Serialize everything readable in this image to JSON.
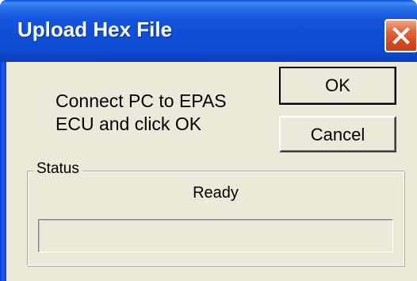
{
  "window": {
    "title": "Upload Hex File",
    "close_icon": "close-icon"
  },
  "message": {
    "line1": "Connect PC to EPAS",
    "line2": "ECU and click OK"
  },
  "buttons": {
    "ok_label": "OK",
    "cancel_label": "Cancel"
  },
  "status": {
    "group_label": "Status",
    "text": "Ready",
    "progress_percent": 0
  },
  "colors": {
    "titlebar": "#0c4ad6",
    "close_button": "#d54a22",
    "dialog_background": "#ece9d8"
  }
}
